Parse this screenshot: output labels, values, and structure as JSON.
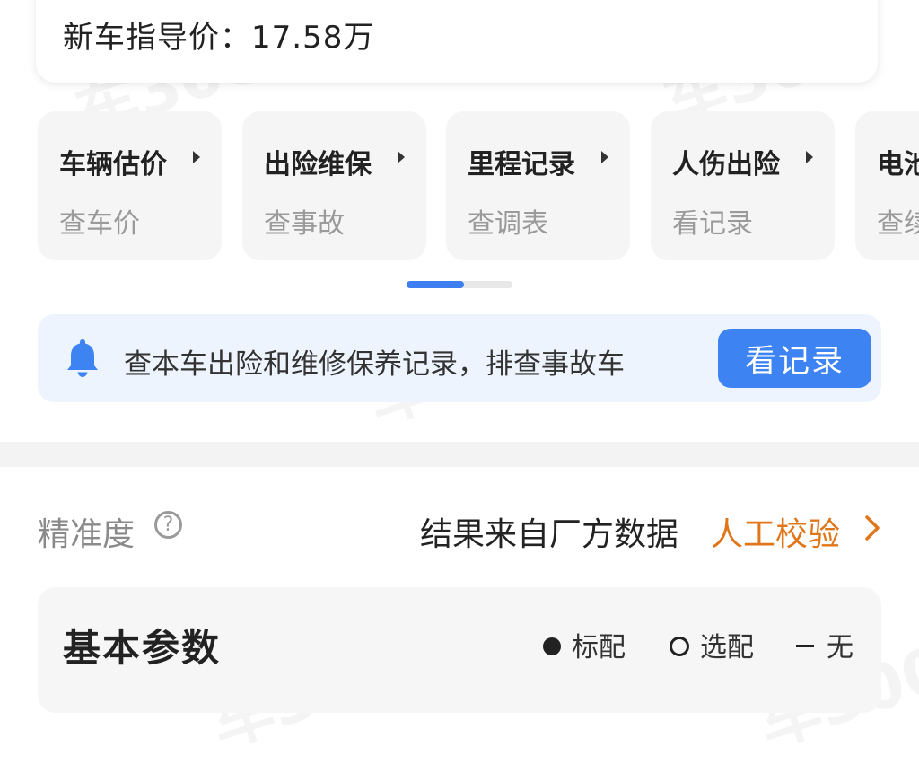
{
  "price": {
    "text": "新车指导价：17.58万"
  },
  "watermark": {
    "text": "车300"
  },
  "services": [
    {
      "title": "车辆估价",
      "subtitle": "查车价"
    },
    {
      "title": "出险维保",
      "subtitle": "查事故"
    },
    {
      "title": "里程记录",
      "subtitle": "查调表"
    },
    {
      "title": "人伤出险",
      "subtitle": "看记录"
    },
    {
      "title": "电池",
      "subtitle": "查续"
    }
  ],
  "pager": {
    "active_index": 0,
    "pages": 2
  },
  "banner": {
    "icon": "bell-icon",
    "text": "查本车出险和维修保养记录，排查事故车",
    "button_label": "看记录"
  },
  "accuracy": {
    "label": "精准度",
    "help_symbol": "?",
    "result_text": "结果来自厂方数据",
    "verify_link": "人工校验"
  },
  "params": {
    "title": "基本参数",
    "legend": [
      {
        "symbol": "filled-dot",
        "label": "标配"
      },
      {
        "symbol": "hollow-dot",
        "label": "选配"
      },
      {
        "symbol": "dash",
        "label": "无"
      }
    ]
  },
  "colors": {
    "accent_blue": "#3d84f2",
    "link_orange": "#e0761a",
    "banner_bg": "#eef4fd",
    "card_bg": "#f5f5f5"
  }
}
